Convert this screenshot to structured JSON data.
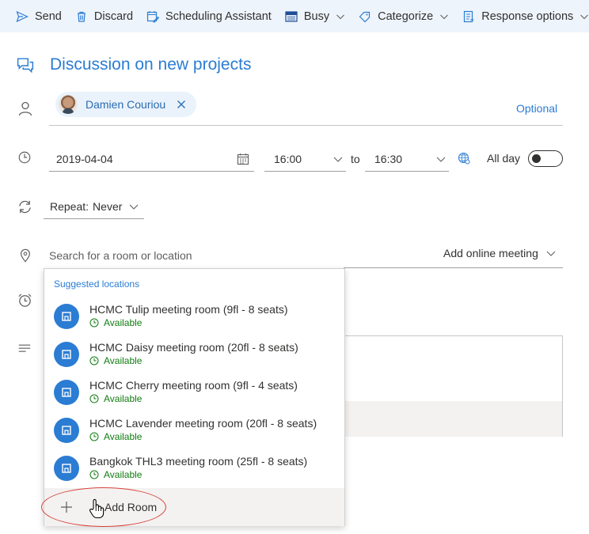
{
  "toolbar": {
    "send": "Send",
    "discard": "Discard",
    "scheduling": "Scheduling Assistant",
    "busy": "Busy",
    "categorize": "Categorize",
    "response": "Response options"
  },
  "event": {
    "title": "Discussion on new projects",
    "attendee": "Damien Couriou",
    "optional_label": "Optional",
    "date": "2019-04-04",
    "start_time": "16:00",
    "to_label": "to",
    "end_time": "16:30",
    "all_day_label": "All day",
    "all_day_on": false,
    "repeat_label": "Repeat:",
    "repeat_value": "Never",
    "location_placeholder": "Search for a room or location",
    "online_meeting": "Add online meeting"
  },
  "locations": {
    "header": "Suggested locations",
    "rooms": [
      {
        "name": "HCMC Tulip meeting room (9fl - 8 seats)",
        "status": "Available"
      },
      {
        "name": "HCMC Daisy meeting room (20fl - 8 seats)",
        "status": "Available"
      },
      {
        "name": "HCMC Cherry meeting room (9fl - 4 seats)",
        "status": "Available"
      },
      {
        "name": "HCMC Lavender meeting room (20fl - 8 seats)",
        "status": "Available"
      },
      {
        "name": "Bangkok THL3 meeting room (25fl - 8 seats)",
        "status": "Available"
      }
    ],
    "add_room": "Add Room"
  },
  "colors": {
    "accent": "#2b7cd3",
    "available": "#107c10",
    "highlight": "#d9403a",
    "toolbar_bg": "#eef4fb"
  }
}
